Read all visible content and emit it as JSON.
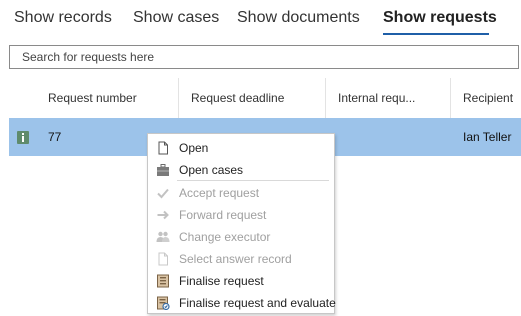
{
  "tabs": {
    "records": "Show records",
    "cases": "Show cases",
    "documents": "Show documents",
    "requests": "Show requests"
  },
  "search": {
    "placeholder": "Search for requests here"
  },
  "grid": {
    "columns": [
      "Request number",
      "Request deadline",
      "Internal requ...",
      "Recipient"
    ],
    "row": {
      "request_number": "77",
      "recipient": "Ian Teller"
    }
  },
  "context_menu": {
    "open": "Open",
    "open_cases": "Open cases",
    "accept_request": "Accept request",
    "forward_request": "Forward request",
    "change_executor": "Change executor",
    "select_answer_record": "Select answer record",
    "finalise_request": "Finalise request",
    "finalise_request_and_evaluate": "Finalise request and evaluate"
  },
  "colors": {
    "accent": "#1f5fa8",
    "selected_row": "#9cc3ea",
    "disabled_text": "#a0a0a0"
  },
  "icons": {
    "row": "info-icon",
    "open": "document-icon",
    "open_cases": "briefcase-icon",
    "accept_request": "check-icon",
    "forward_request": "arrow-right-icon",
    "change_executor": "users-icon",
    "select_answer_record": "document-icon",
    "finalise_request": "archive-icon",
    "finalise_request_and_evaluate": "archive-evaluate-icon"
  }
}
